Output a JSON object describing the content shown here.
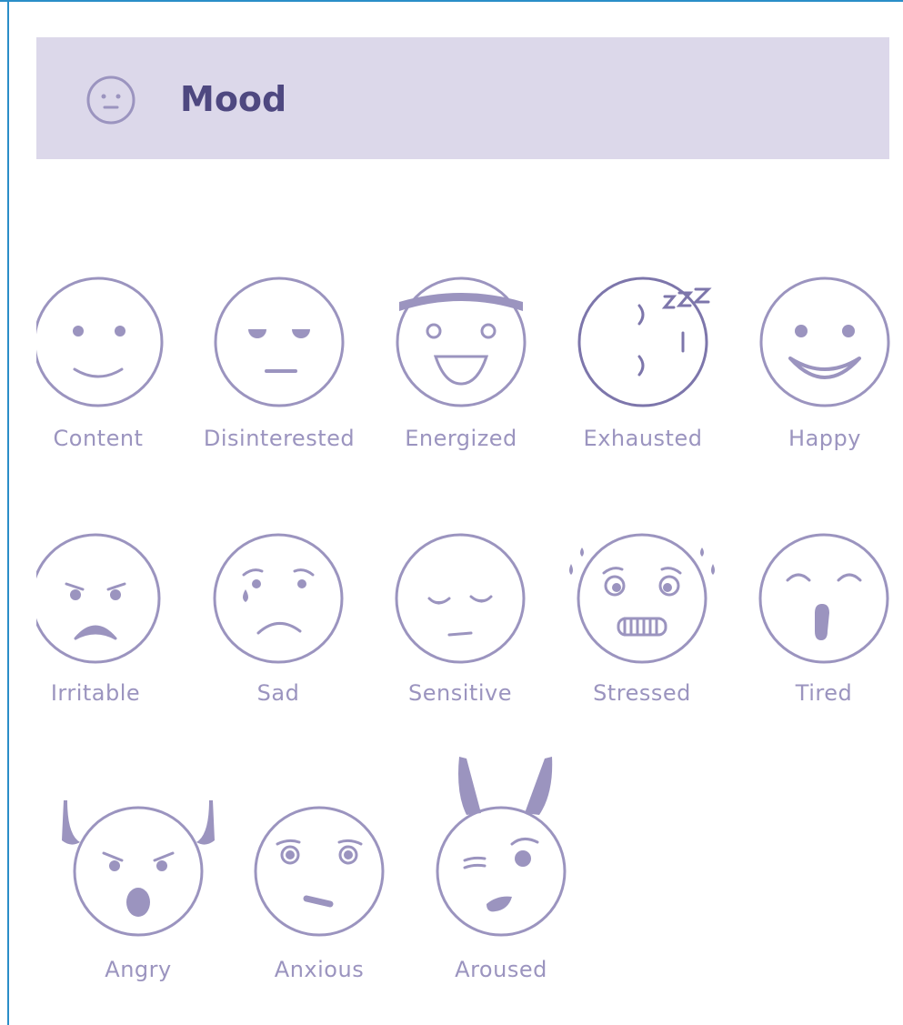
{
  "header": {
    "title": "Mood",
    "icon": "neutral-face-icon"
  },
  "colors": {
    "accent": "#9b94bf",
    "header_bg": "#dcd8ea",
    "title": "#4e4880"
  },
  "moods": [
    {
      "label": "Content",
      "icon": "content-face-icon"
    },
    {
      "label": "Disinterested",
      "icon": "disinterested-face-icon"
    },
    {
      "label": "Energized",
      "icon": "energized-face-icon"
    },
    {
      "label": "Exhausted",
      "icon": "exhausted-face-icon"
    },
    {
      "label": "Happy",
      "icon": "happy-face-icon"
    },
    {
      "label": "Irritable",
      "icon": "irritable-face-icon"
    },
    {
      "label": "Sad",
      "icon": "sad-face-icon"
    },
    {
      "label": "Sensitive",
      "icon": "sensitive-face-icon"
    },
    {
      "label": "Stressed",
      "icon": "stressed-face-icon"
    },
    {
      "label": "Tired",
      "icon": "tired-face-icon"
    },
    {
      "label": "Angry",
      "icon": "angry-face-icon"
    },
    {
      "label": "Anxious",
      "icon": "anxious-face-icon"
    },
    {
      "label": "Aroused",
      "icon": "aroused-face-icon"
    }
  ]
}
